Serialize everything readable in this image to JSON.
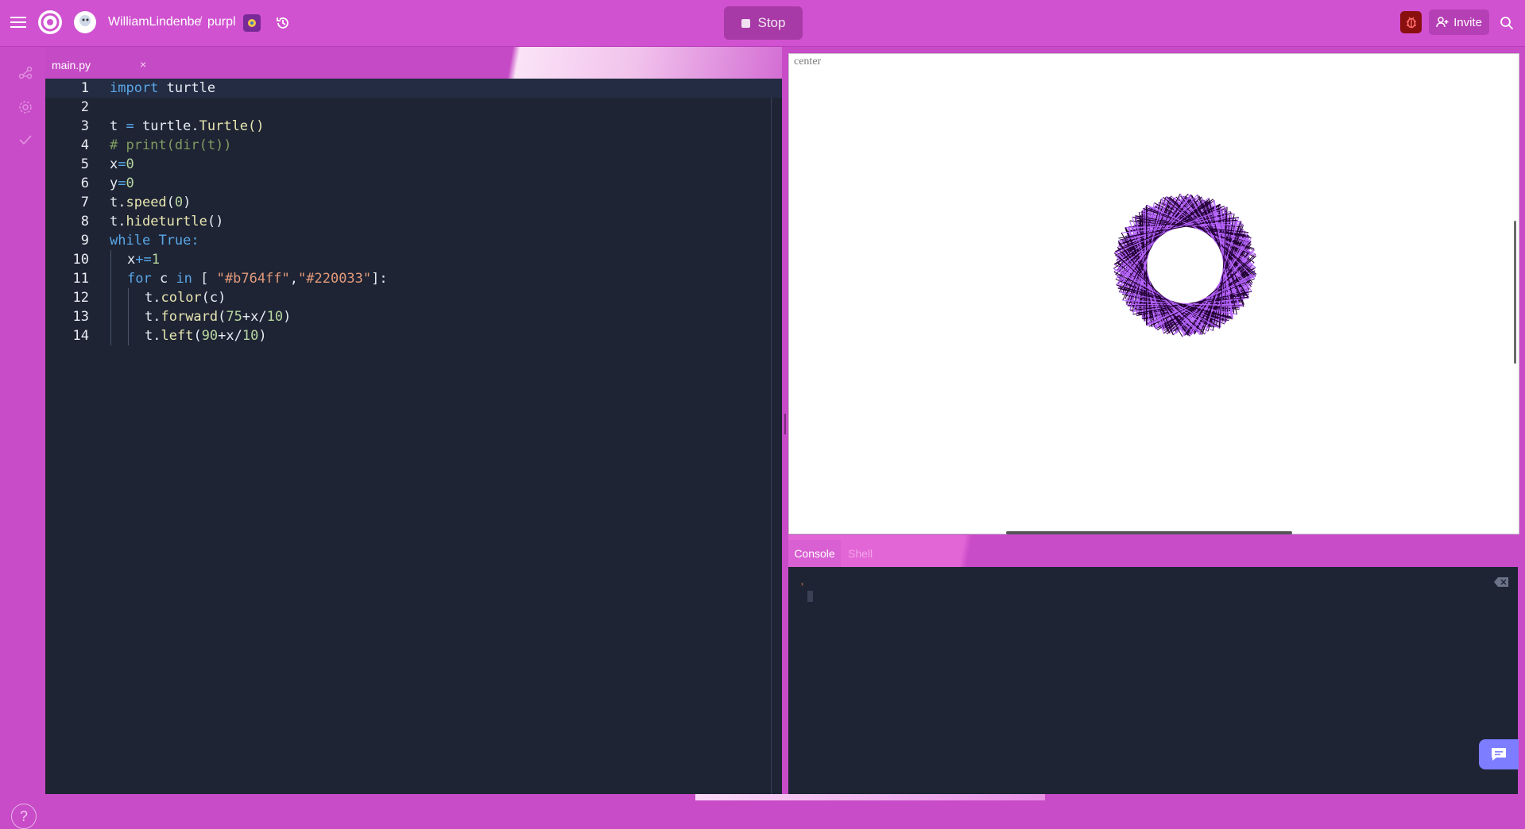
{
  "header": {
    "user": "WilliamLindenbe",
    "separator": "/",
    "repl_name": "purpl",
    "run_button_label": "Stop",
    "invite_label": "Invite"
  },
  "editor": {
    "tab_label": "main.py",
    "tab_close": "×",
    "lines": [
      {
        "num": "1"
      },
      {
        "num": "2"
      },
      {
        "num": "3"
      },
      {
        "num": "4"
      },
      {
        "num": "5"
      },
      {
        "num": "6"
      },
      {
        "num": "7"
      },
      {
        "num": "8"
      },
      {
        "num": "9"
      },
      {
        "num": "10"
      },
      {
        "num": "11"
      },
      {
        "num": "12"
      },
      {
        "num": "13"
      },
      {
        "num": "14"
      }
    ],
    "code": {
      "l1_kw": "import",
      "l1_rest": " turtle",
      "l3_a": "t ",
      "l3_op": "=",
      "l3_b": " turtle.",
      "l3_fn": "Turtle()",
      "l4": "# print(dir(t))",
      "l5_a": "x",
      "l5_op": "=",
      "l5_n": "0",
      "l6_a": "y",
      "l6_op": "=",
      "l6_n": "0",
      "l7_a": "t.",
      "l7_fn": "speed",
      "l7_b": "(",
      "l7_n": "0",
      "l7_c": ")",
      "l8_a": "t.",
      "l8_fn": "hideturtle",
      "l8_b": "()",
      "l9_kw": "while",
      "l9_sp": " ",
      "l9_kw2": "True",
      "l9_c": ":",
      "l10_a": "x",
      "l10_op": "+=",
      "l10_n": "1",
      "l11_kw": "for",
      "l11_a": " c ",
      "l11_kw2": "in",
      "l11_b": " [ ",
      "l11_s1": "\"#b764ff\"",
      "l11_comma": ",",
      "l11_s2": "\"#220033\"",
      "l11_c": "]:",
      "l12_a": "t.",
      "l12_fn": "color",
      "l12_b": "(c)",
      "l13_a": "t.",
      "l13_fn": "forward",
      "l13_b": "(",
      "l13_n": "75",
      "l13_c": "+x/",
      "l13_n2": "10",
      "l13_d": ")",
      "l14_a": "t.",
      "l14_fn": "left",
      "l14_b": "(",
      "l14_n": "90",
      "l14_c": "+x/",
      "l14_n2": "10",
      "l14_d": ")"
    }
  },
  "output": {
    "canvas_label": "center"
  },
  "console": {
    "tab_console": "Console",
    "tab_shell": "Shell",
    "prompt_symbol": "›"
  },
  "sidebar": {
    "help_label": "?"
  },
  "colors": {
    "accent": "#d052d0",
    "turtle_color_1": "#b764ff",
    "turtle_color_2": "#220033",
    "editor_bg": "#1e2434"
  }
}
